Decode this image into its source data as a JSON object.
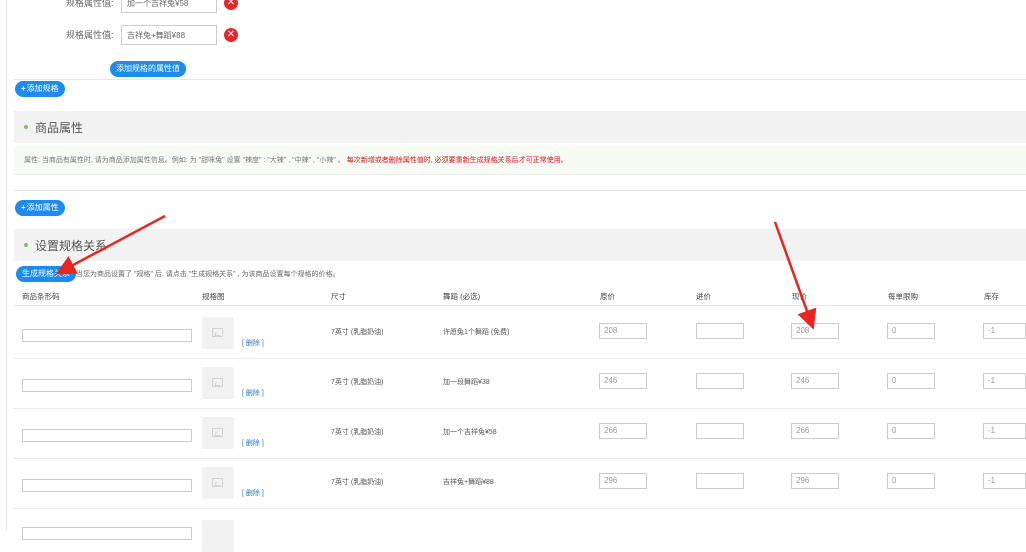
{
  "attr_values": [
    {
      "label": "规格属性值:",
      "value": "加一个吉祥兔¥58"
    },
    {
      "label": "规格属性值:",
      "value": "吉祥兔+舞蹈¥88"
    }
  ],
  "delete_glyph": "✕",
  "add_attr_value_button": "添加规格的属性值",
  "add_spec_button": {
    "plus": "+",
    "label": "添加规格"
  },
  "goods_attr_section": {
    "title": "商品属性",
    "notice_gray": "属性: 当商品有属性时, 请为商品添加属性信息。例如: 为 \"甜咪兔\" 设置 \"辣度\" : \"大辣\" , \"中辣\" , \"小辣\" 。",
    "notice_red": "每次新增或者删除属性值时, 必须要重新生成规格关系后才可正常使用。"
  },
  "add_attribute_button": {
    "plus": "+",
    "label": "添加属性"
  },
  "spec_relation_section": {
    "title": "设置规格关系",
    "generate_button": "生成规格关系",
    "hint": "当您为商品设置了 \"规格\" 后, 请点击 \"生成规格关系\" , 为该商品设置每个规格的价格。"
  },
  "table": {
    "headers": [
      "商品条形码",
      "规格图",
      "尺寸",
      "舞蹈 (必选)",
      "原价",
      "进价",
      "现价",
      "每单限购",
      "库存"
    ],
    "delete_label": "[ 删除 ]",
    "rows": [
      {
        "size": "7英寸 (乳脂奶油)",
        "dance": "许愿兔1个舞蹈 (免费)",
        "orig": "208",
        "cost": "",
        "price": "208",
        "limit": "0",
        "stock": "-1"
      },
      {
        "size": "7英寸 (乳脂奶油)",
        "dance": "加一段舞蹈¥38",
        "orig": "246",
        "cost": "",
        "price": "246",
        "limit": "0",
        "stock": "-1"
      },
      {
        "size": "7英寸 (乳脂奶油)",
        "dance": "加一个吉祥兔¥58",
        "orig": "266",
        "cost": "",
        "price": "266",
        "limit": "0",
        "stock": "-1"
      },
      {
        "size": "7英寸 (乳脂奶油)",
        "dance": "吉祥兔+舞蹈¥88",
        "orig": "296",
        "cost": "",
        "price": "296",
        "limit": "0",
        "stock": "-1"
      }
    ]
  },
  "colors": {
    "accent": "#1e8bf0",
    "danger": "#e22a2a",
    "arrow": "#e8251f",
    "link": "#2a78c9"
  }
}
